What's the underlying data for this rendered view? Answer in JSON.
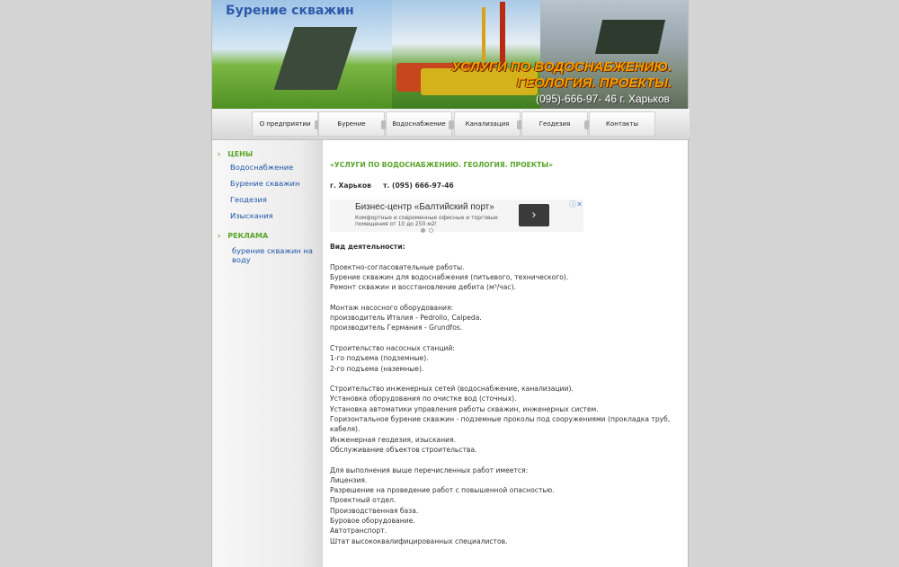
{
  "header": {
    "site_name": "Бурение скважин",
    "slogan_line1": "УСЛУГИ ПО ВОДОСНАБЖЕНИЮ.",
    "slogan_line2": "ГЕОЛОГИЯ. ПРОЕКТЫ.",
    "phone": "(095)-666-97- 46 г. Харьков"
  },
  "nav": {
    "items": [
      {
        "label": "О предприятии"
      },
      {
        "label": "Бурение"
      },
      {
        "label": "Водоснабжение"
      },
      {
        "label": "Канализация"
      },
      {
        "label": "Геодезия"
      },
      {
        "label": "Контакты"
      }
    ]
  },
  "sidebar": {
    "section1_title": "ЦЕНЫ",
    "section1_links": [
      "Водоснабжение",
      "Бурение скважин",
      "Геодезия",
      "Изыскания"
    ],
    "section2_title": "РЕКЛАМА",
    "section2_links": [
      "бурение скважин на воду"
    ]
  },
  "content": {
    "title": "«УСЛУГИ ПО ВОДОСНАБЖЕНИЮ. ГЕОЛОГИЯ. ПРОЕКТЫ»",
    "city_phone": "г. Харьков     т. (095) 666-97-46",
    "ad": {
      "title": "Бизнес-центр «Балтийский порт»",
      "description": "Комфортные и современные офисные и торговые помещения от 10 до 250 м2!",
      "button_icon": "chevron-right-icon"
    },
    "activity_label": "Вид деятельности:",
    "paragraphs": [
      [
        "Проектно-согласовательные работы.",
        "Бурение скважин для водоснабжения (питьевого, технического).",
        "Ремонт скважин и восстановление дебита (м³/час)."
      ],
      [
        "Монтаж насосного оборудования:",
        "производитель Италия - Pedrollo, Calpeda.",
        "производитель Германия - Grundfos."
      ],
      [
        "Строительство насосных станций:",
        "1-го подъема (подземные).",
        "2-го подъема (наземные)."
      ],
      [
        "Строительство инженерных сетей (водоснабжение, канализации).",
        "Установка оборудования по очистке вод (сточных).",
        "Установка автоматики управления работы скважин, инженерных систем.",
        "Горизонтальное бурение скважин - подземные проколы под сооружениями (прокладка труб, кабеля).",
        "Инженерная геодезия, изыскания.",
        "Обслуживание объектов строительства."
      ],
      [
        "Для выполнения выше перечисленных работ имеется:",
        "Лицензия.",
        "Разрешение на проведение работ с повышенной опасностью.",
        "Проектный отдел.",
        "Производственная база.",
        "Буровое оборудование.",
        "Автотранспорт.",
        "Штат высококвалифицированных специалистов."
      ]
    ]
  }
}
